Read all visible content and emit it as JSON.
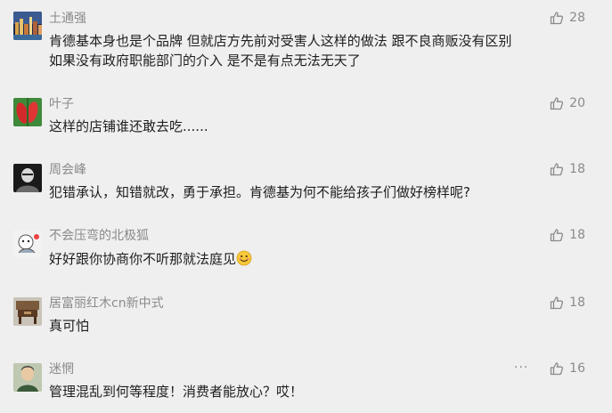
{
  "comments": [
    {
      "name": "土通强",
      "text1": "肯德基本身也是个品牌   但就店方先前对受害人这样的做法   跟不良商贩没有区别",
      "text2": "如果没有政府职能部门的介入   是不是有点无法无天了",
      "likes": "28",
      "avatar_icon": "city-night-avatar"
    },
    {
      "name": "叶子",
      "text1": "这样的店铺谁还敢去吃......",
      "likes": "20",
      "avatar_icon": "red-leaves-avatar"
    },
    {
      "name": "周会峰",
      "text1": "犯错承认，知错就改，勇于承担。肯德基为何不能给孩子们做好榜样呢?",
      "likes": "18",
      "avatar_icon": "portrait-avatar"
    },
    {
      "name": "不会压弯的北极狐",
      "text1": "好好跟你协商你不听那就法庭见",
      "likes": "18",
      "avatar_icon": "cartoon-avatar"
    },
    {
      "name": "居富丽红木cn新中式",
      "text1": "真可怕",
      "likes": "18",
      "avatar_icon": "furniture-avatar"
    },
    {
      "name": "迷惘",
      "text1": "管理混乱到何等程度！消费者能放心？哎！",
      "likes": "16",
      "avatar_icon": "person-avatar",
      "more": "···"
    }
  ]
}
